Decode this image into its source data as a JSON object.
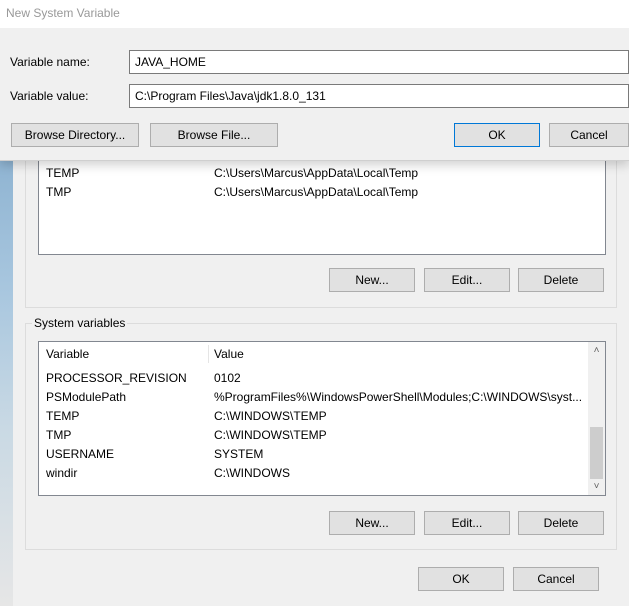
{
  "dialog": {
    "title": "New System Variable",
    "name_label": "Variable name:",
    "name_value": "JAVA_HOME",
    "value_label": "Variable value:",
    "value_value": "C:\\Program Files\\Java\\jdk1.8.0_131",
    "browse_dir_label": "Browse Directory...",
    "browse_file_label": "Browse File...",
    "ok_label": "OK",
    "cancel_label": "Cancel"
  },
  "user_vars": {
    "rows": [
      {
        "name": "TEMP",
        "value": "C:\\Users\\Marcus\\AppData\\Local\\Temp"
      },
      {
        "name": "TMP",
        "value": "C:\\Users\\Marcus\\AppData\\Local\\Temp"
      }
    ],
    "new_label": "New...",
    "edit_label": "Edit...",
    "delete_label": "Delete"
  },
  "system_vars": {
    "group_label": "System variables",
    "col_variable": "Variable",
    "col_value": "Value",
    "rows": [
      {
        "name": "PROCESSOR_REVISION",
        "value": "0102"
      },
      {
        "name": "PSModulePath",
        "value": "%ProgramFiles%\\WindowsPowerShell\\Modules;C:\\WINDOWS\\syst..."
      },
      {
        "name": "TEMP",
        "value": "C:\\WINDOWS\\TEMP"
      },
      {
        "name": "TMP",
        "value": "C:\\WINDOWS\\TEMP"
      },
      {
        "name": "USERNAME",
        "value": "SYSTEM"
      },
      {
        "name": "windir",
        "value": "C:\\WINDOWS"
      }
    ],
    "new_label": "New...",
    "edit_label": "Edit...",
    "delete_label": "Delete"
  },
  "footer": {
    "ok_label": "OK",
    "cancel_label": "Cancel"
  }
}
